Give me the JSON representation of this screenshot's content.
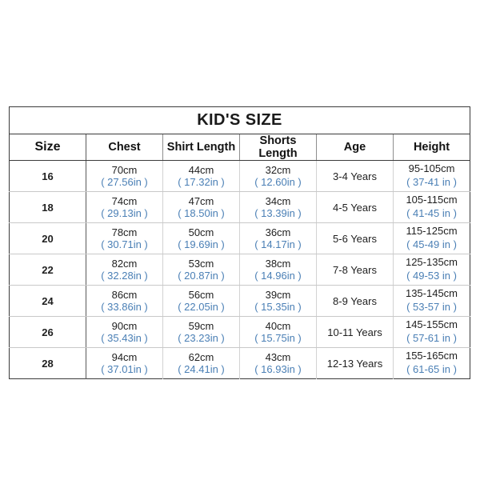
{
  "chart_data": {
    "type": "table",
    "title": "KID'S SIZE",
    "columns": [
      "Size",
      "Chest",
      "Shirt Length",
      "Shorts Length",
      "Age",
      "Height"
    ],
    "rows": [
      {
        "size": "16",
        "chest_cm": "70cm",
        "chest_in": "( 27.56in )",
        "shirt_cm": "44cm",
        "shirt_in": "( 17.32in )",
        "shorts_cm": "32cm",
        "shorts_in": "( 12.60in )",
        "age": "3-4 Years",
        "height_cm": "95-105cm",
        "height_in": "( 37-41 in )"
      },
      {
        "size": "18",
        "chest_cm": "74cm",
        "chest_in": "( 29.13in )",
        "shirt_cm": "47cm",
        "shirt_in": "( 18.50in )",
        "shorts_cm": "34cm",
        "shorts_in": "( 13.39in )",
        "age": "4-5 Years",
        "height_cm": "105-115cm",
        "height_in": "( 41-45 in )"
      },
      {
        "size": "20",
        "chest_cm": "78cm",
        "chest_in": "( 30.71in )",
        "shirt_cm": "50cm",
        "shirt_in": "( 19.69in )",
        "shorts_cm": "36cm",
        "shorts_in": "( 14.17in )",
        "age": "5-6 Years",
        "height_cm": "115-125cm",
        "height_in": "( 45-49 in )"
      },
      {
        "size": "22",
        "chest_cm": "82cm",
        "chest_in": "( 32.28in )",
        "shirt_cm": "53cm",
        "shirt_in": "( 20.87in )",
        "shorts_cm": "38cm",
        "shorts_in": "( 14.96in )",
        "age": "7-8 Years",
        "height_cm": "125-135cm",
        "height_in": "( 49-53 in )"
      },
      {
        "size": "24",
        "chest_cm": "86cm",
        "chest_in": "( 33.86in )",
        "shirt_cm": "56cm",
        "shirt_in": "( 22.05in )",
        "shorts_cm": "39cm",
        "shorts_in": "( 15.35in )",
        "age": "8-9 Years",
        "height_cm": "135-145cm",
        "height_in": "( 53-57 in )"
      },
      {
        "size": "26",
        "chest_cm": "90cm",
        "chest_in": "( 35.43in )",
        "shirt_cm": "59cm",
        "shirt_in": "( 23.23in )",
        "shorts_cm": "40cm",
        "shorts_in": "( 15.75in )",
        "age": "10-11 Years",
        "height_cm": "145-155cm",
        "height_in": "( 57-61 in )"
      },
      {
        "size": "28",
        "chest_cm": "94cm",
        "chest_in": "( 37.01in )",
        "shirt_cm": "62cm",
        "shirt_in": "( 24.41in )",
        "shorts_cm": "43cm",
        "shorts_in": "( 16.93in )",
        "age": "12-13 Years",
        "height_cm": "155-165cm",
        "height_in": "( 61-65 in )"
      }
    ],
    "colors": {
      "inch_text": "#4a7fb5",
      "cm_text": "#1f1f1f",
      "border_outer": "#3b3b3b",
      "border_inner": "#d2d2d2",
      "background": "#ffffff"
    }
  }
}
